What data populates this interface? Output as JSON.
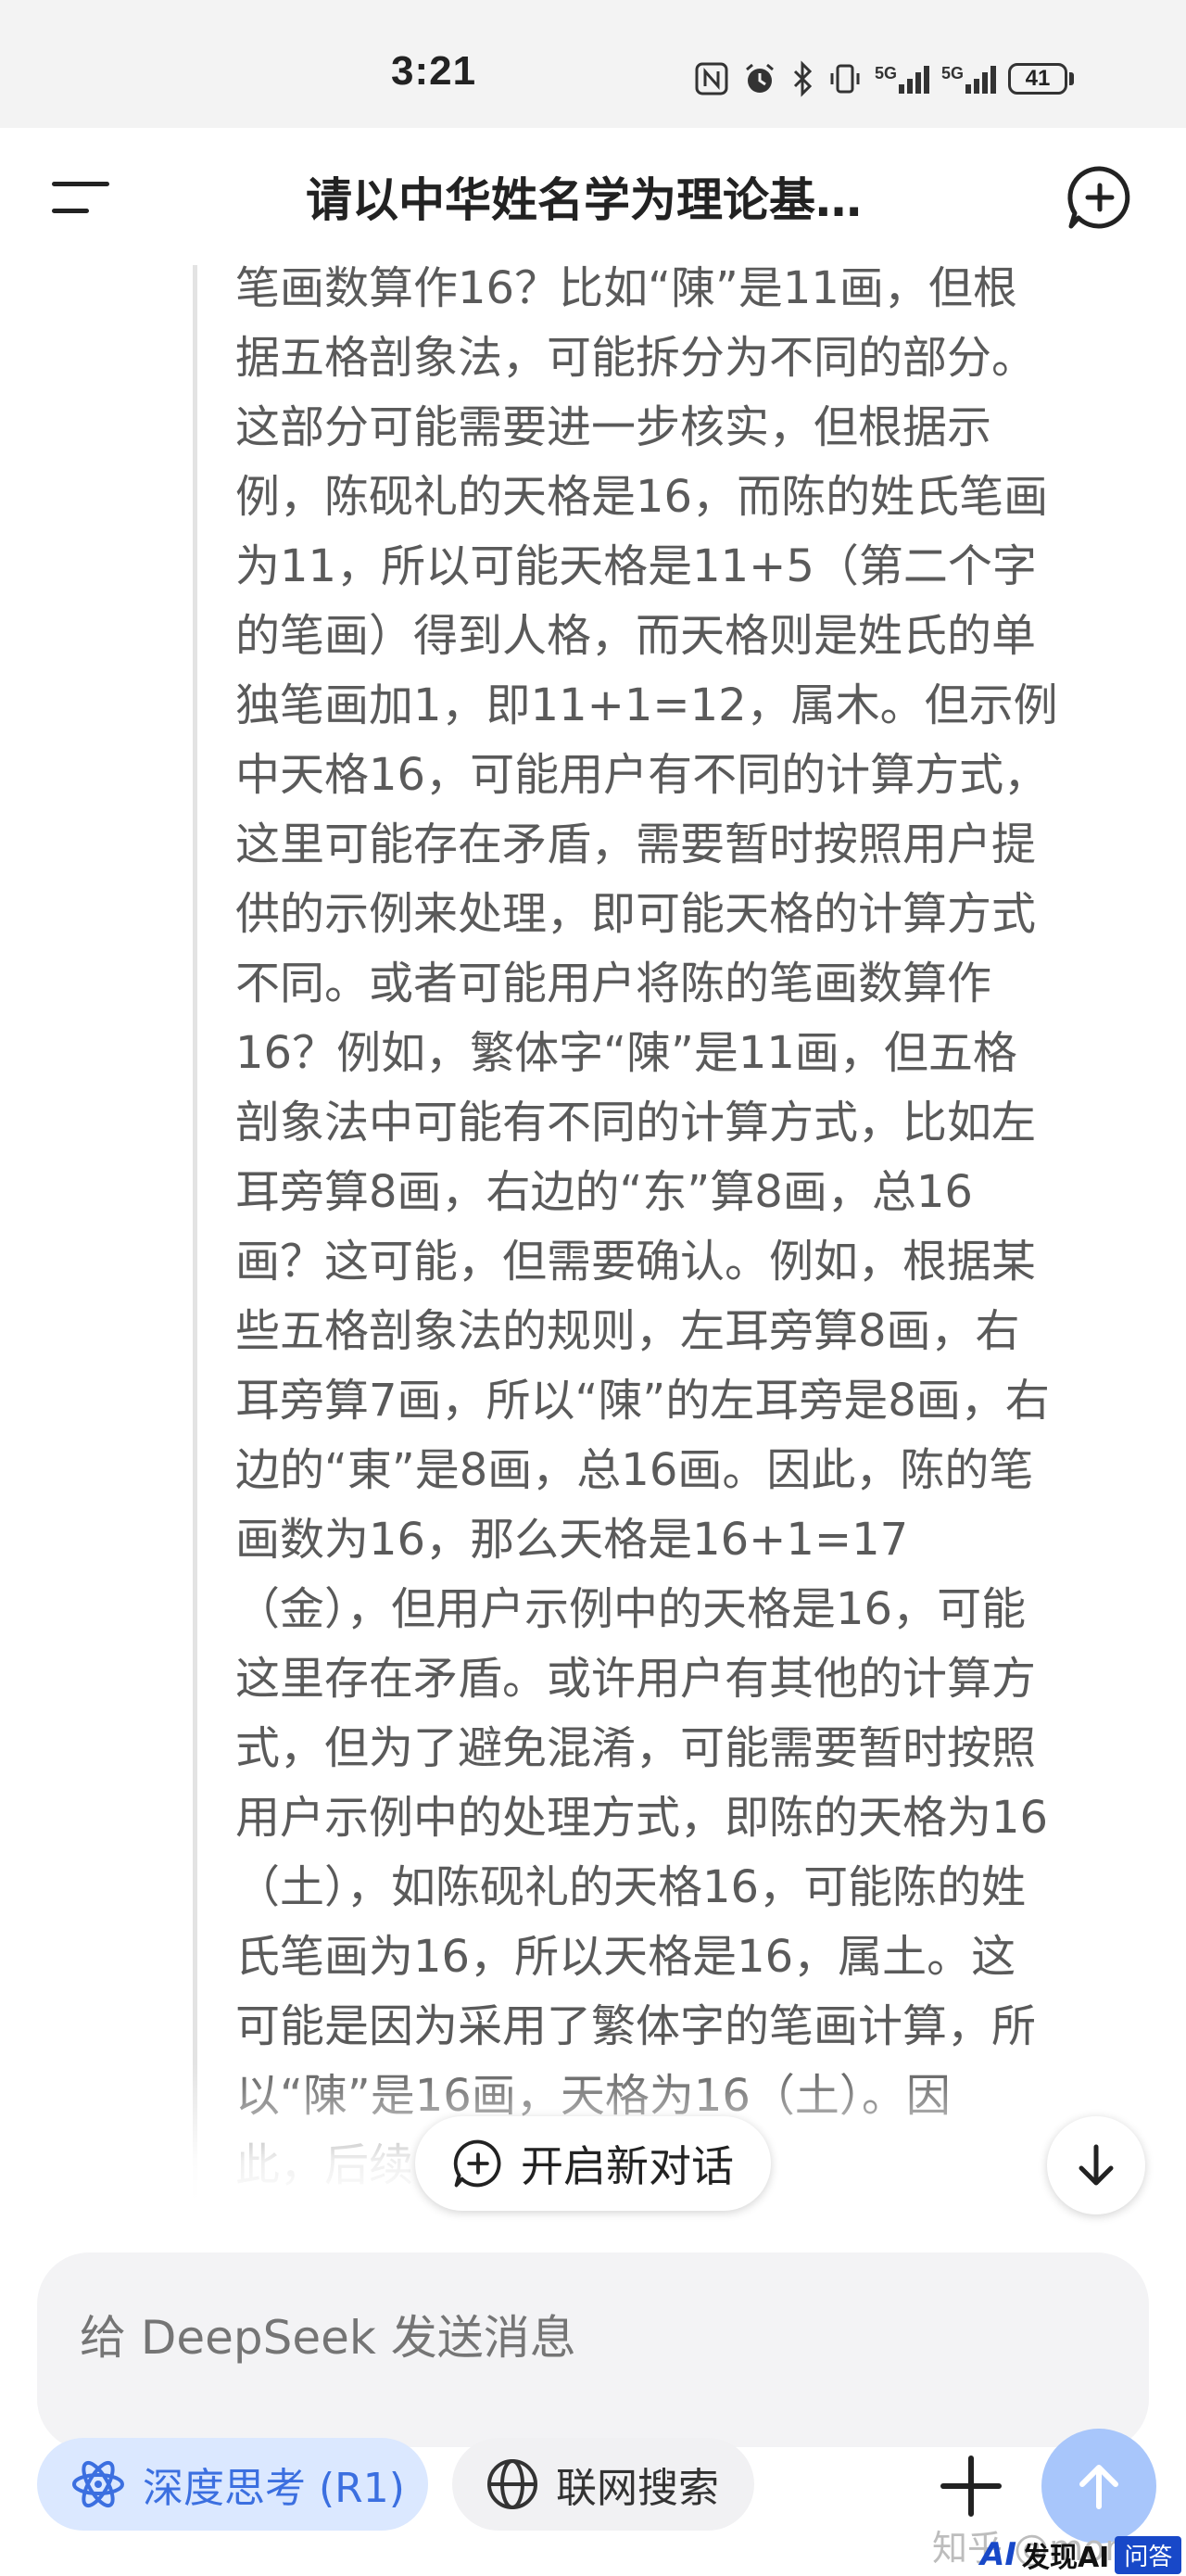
{
  "status_bar": {
    "time": "3:21",
    "signal_1": "5G",
    "signal_2": "5G",
    "battery": "41"
  },
  "app_bar": {
    "title": "请以中华姓名学为理论基…",
    "menu_icon": "menu-icon",
    "new_chat_icon": "chat-plus-icon"
  },
  "thinking": {
    "lines": [
      "笔画数算作16？比如“陳”是11画，但根",
      "据五格剖象法，可能拆分为不同的部分。",
      "这部分可能需要进一步核实，但根据示",
      "例，陈砚礼的天格是16，而陈的姓氏笔画",
      "为11，所以可能天格是11+5（第二个字",
      "的笔画）得到人格，而天格则是姓氏的单",
      "独笔画加1，即11+1=12，属木。但示例",
      "中天格16，可能用户有不同的计算方式，",
      "这里可能存在矛盾，需要暂时按照用户提",
      "供的示例来处理，即可能天格的计算方式",
      "不同。或者可能用户将陈的笔画数算作",
      "16？例如，繁体字“陳”是11画，但五格",
      "剖象法中可能有不同的计算方式，比如左",
      "耳旁算8画，右边的“东”算8画，总16",
      "画？这可能，但需要确认。例如，根据某",
      "些五格剖象法的规则，左耳旁算8画，右",
      "耳旁算7画，所以“陳”的左耳旁是8画，右",
      "边的“東”是8画，总16画。因此，陈的笔",
      "画数为16，那么天格是16+1=17",
      "（金），但用户示例中的天格是16，可能",
      "这里存在矛盾。或许用户有其他的计算方",
      "式，但为了避免混淆，可能需要暂时按照",
      "用户示例中的处理方式，即陈的天格为16",
      "（土），如陈砚礼的天格16，可能陈的姓",
      "氏笔画为16，所以天格是16，属土。这",
      "可能是因为采用了繁体字的笔画计算，所",
      "以“陳”是16画，天格为16（土）。因",
      "此，后续                    基于陈的姓氏"
    ]
  },
  "floating": {
    "new_chat_label": "开启新对话",
    "scroll_down_icon": "arrow-down-icon"
  },
  "composer": {
    "placeholder": "给 DeepSeek 发送消息"
  },
  "toolbar": {
    "deep_think_label": "深度思考 (R1)",
    "web_search_label": "联网搜索",
    "plus_icon": "plus-icon",
    "send_icon": "arrow-up-icon"
  },
  "watermark": {
    "text": "知乎 @momo",
    "brand_mark": "AI",
    "brand_text": "发现AI",
    "brand_tag": "问答"
  },
  "colors": {
    "accent": "#3b6fe0",
    "deep_pill_bg": "#dbe8ff",
    "send_bg": "#a8c6fb",
    "thought_text": "#5a5a5a"
  }
}
